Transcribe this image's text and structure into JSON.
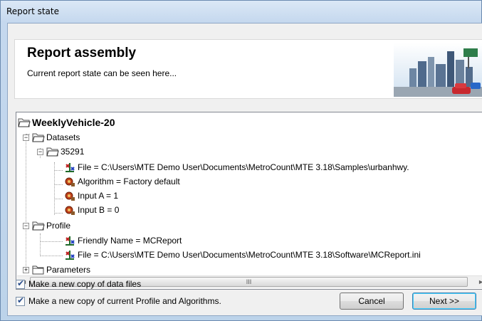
{
  "window": {
    "title": "Report state"
  },
  "header": {
    "title": "Report assembly",
    "subtitle": "Current report state can be seen here..."
  },
  "tree": {
    "root": "WeeklyVehicle-20",
    "datasets": "Datasets",
    "dataset_id": "35291",
    "dataset_file": "File = C:\\Users\\MTE Demo User\\Documents\\MetroCount\\MTE 3.18\\Samples\\urbanhwy.",
    "algorithm": "Algorithm = Factory default",
    "input_a": "Input A = 1",
    "input_b": "Input B = 0",
    "profile": "Profile",
    "friendly_name": "Friendly Name = MCReport",
    "profile_file": "File = C:\\Users\\MTE Demo User\\Documents\\MetroCount\\MTE 3.18\\Software\\MCReport.ini",
    "parameters": "Parameters"
  },
  "options": {
    "copy_data_files": "Make a new copy of data files",
    "copy_profile": "Make a new copy of current Profile and Algorithms."
  },
  "buttons": {
    "cancel": "Cancel",
    "next": "Next >>"
  },
  "scrollbar": {
    "grip": "III"
  }
}
